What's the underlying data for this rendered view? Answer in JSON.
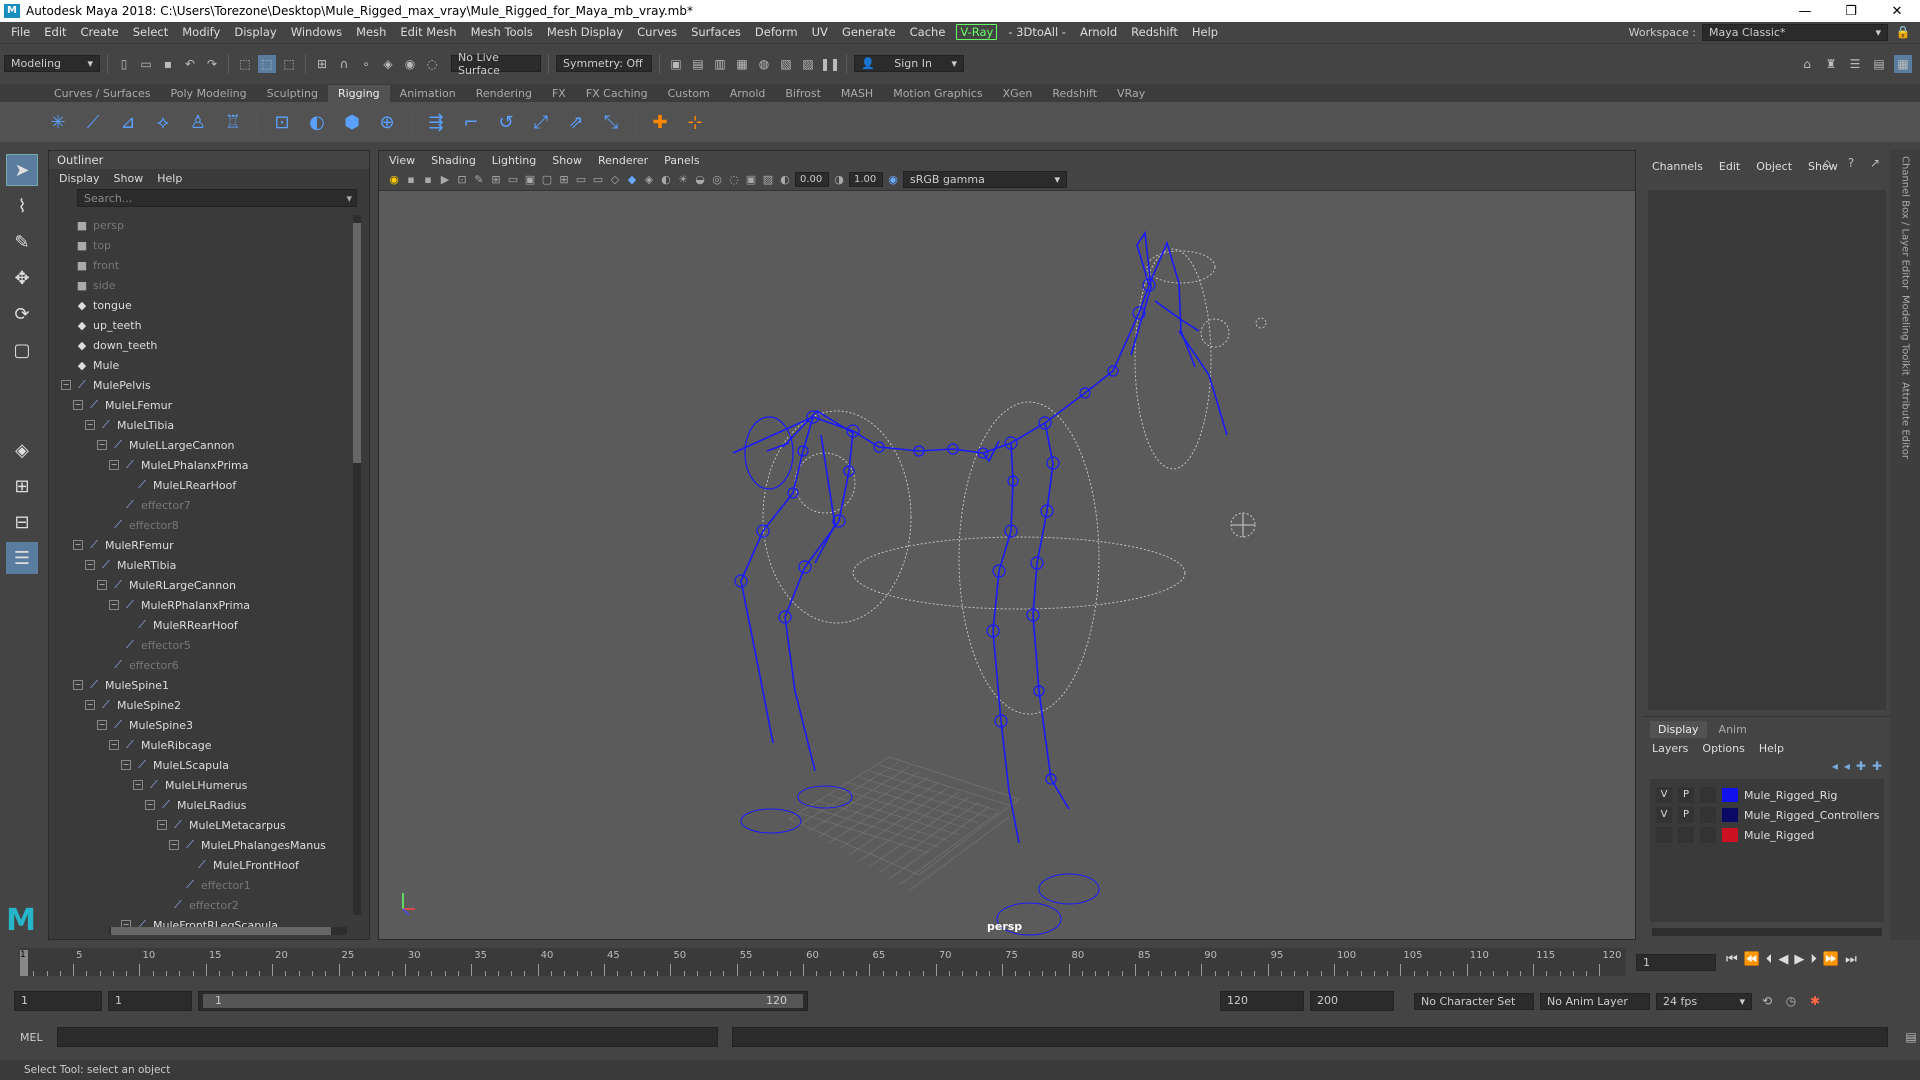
{
  "titlebar": {
    "logo": "M",
    "title": "Autodesk Maya 2018: C:\\Users\\Torezone\\Desktop\\Mule_Rigged_max_vray\\Mule_Rigged_for_Maya_mb_vray.mb*",
    "minimize": "—",
    "maximize": "❐",
    "close": "✕"
  },
  "menubar": {
    "items": [
      "File",
      "Edit",
      "Create",
      "Select",
      "Modify",
      "Display",
      "Windows",
      "Mesh",
      "Edit Mesh",
      "Mesh Tools",
      "Mesh Display",
      "Curves",
      "Surfaces",
      "Deform",
      "UV",
      "Generate",
      "Cache"
    ],
    "vray": "V-Ray",
    "items2": [
      "- 3DtoAll -",
      "Arnold",
      "Redshift",
      "Help"
    ],
    "workspace_label": "Workspace :",
    "workspace_value": "Maya Classic*"
  },
  "statusline": {
    "mode": "Modeling",
    "live_surface": "No Live Surface",
    "symmetry": "Symmetry: Off",
    "sign_in": "Sign In"
  },
  "shelf": {
    "tabs": [
      "Curves / Surfaces",
      "Poly Modeling",
      "Sculpting",
      "Rigging",
      "Animation",
      "Rendering",
      "FX",
      "FX Caching",
      "Custom",
      "Arnold",
      "Bifrost",
      "MASH",
      "Motion Graphics",
      "XGen",
      "Redshift",
      "VRay"
    ],
    "active": "Rigging"
  },
  "outliner": {
    "title": "Outliner",
    "menu": [
      "Display",
      "Show",
      "Help"
    ],
    "search_placeholder": "Search...",
    "items": [
      {
        "label": "persp",
        "depth": 0,
        "type": "cam",
        "dim": true,
        "exp": ""
      },
      {
        "label": "top",
        "depth": 0,
        "type": "cam",
        "dim": true,
        "exp": ""
      },
      {
        "label": "front",
        "depth": 0,
        "type": "cam",
        "dim": true,
        "exp": ""
      },
      {
        "label": "side",
        "depth": 0,
        "type": "cam",
        "dim": true,
        "exp": ""
      },
      {
        "label": "tongue",
        "depth": 0,
        "type": "mesh",
        "dim": false,
        "exp": ""
      },
      {
        "label": "up_teeth",
        "depth": 0,
        "type": "mesh",
        "dim": false,
        "exp": ""
      },
      {
        "label": "down_teeth",
        "depth": 0,
        "type": "mesh",
        "dim": false,
        "exp": ""
      },
      {
        "label": "Mule",
        "depth": 0,
        "type": "mesh",
        "dim": false,
        "exp": ""
      },
      {
        "label": "MulePelvis",
        "depth": 0,
        "type": "joint",
        "dim": false,
        "exp": "−"
      },
      {
        "label": "MuleLFemur",
        "depth": 1,
        "type": "joint",
        "dim": false,
        "exp": "−"
      },
      {
        "label": "MuleLTibia",
        "depth": 2,
        "type": "joint",
        "dim": false,
        "exp": "−"
      },
      {
        "label": "MuleLLargeCannon",
        "depth": 3,
        "type": "joint",
        "dim": false,
        "exp": "−"
      },
      {
        "label": "MuleLPhalanxPrima",
        "depth": 4,
        "type": "joint",
        "dim": false,
        "exp": "−"
      },
      {
        "label": "MuleLRearHoof",
        "depth": 5,
        "type": "joint",
        "dim": false,
        "exp": ""
      },
      {
        "label": "effector7",
        "depth": 4,
        "type": "joint",
        "dim": true,
        "exp": ""
      },
      {
        "label": "effector8",
        "depth": 3,
        "type": "joint",
        "dim": true,
        "exp": ""
      },
      {
        "label": "MuleRFemur",
        "depth": 1,
        "type": "joint",
        "dim": false,
        "exp": "−"
      },
      {
        "label": "MuleRTibia",
        "depth": 2,
        "type": "joint",
        "dim": false,
        "exp": "−"
      },
      {
        "label": "MuleRLargeCannon",
        "depth": 3,
        "type": "joint",
        "dim": false,
        "exp": "−"
      },
      {
        "label": "MuleRPhalanxPrima",
        "depth": 4,
        "type": "joint",
        "dim": false,
        "exp": "−"
      },
      {
        "label": "MuleRRearHoof",
        "depth": 5,
        "type": "joint",
        "dim": false,
        "exp": ""
      },
      {
        "label": "effector5",
        "depth": 4,
        "type": "joint",
        "dim": true,
        "exp": ""
      },
      {
        "label": "effector6",
        "depth": 3,
        "type": "joint",
        "dim": true,
        "exp": ""
      },
      {
        "label": "MuleSpine1",
        "depth": 1,
        "type": "joint",
        "dim": false,
        "exp": "−"
      },
      {
        "label": "MuleSpine2",
        "depth": 2,
        "type": "joint",
        "dim": false,
        "exp": "−"
      },
      {
        "label": "MuleSpine3",
        "depth": 3,
        "type": "joint",
        "dim": false,
        "exp": "−"
      },
      {
        "label": "MuleRibcage",
        "depth": 4,
        "type": "joint",
        "dim": false,
        "exp": "−"
      },
      {
        "label": "MuleLScapula",
        "depth": 5,
        "type": "joint",
        "dim": false,
        "exp": "−"
      },
      {
        "label": "MuleLHumerus",
        "depth": 6,
        "type": "joint",
        "dim": false,
        "exp": "−"
      },
      {
        "label": "MuleLRadius",
        "depth": 7,
        "type": "joint",
        "dim": false,
        "exp": "−"
      },
      {
        "label": "MuleLMetacarpus",
        "depth": 8,
        "type": "joint",
        "dim": false,
        "exp": "−"
      },
      {
        "label": "MuleLPhalangesManus",
        "depth": 9,
        "type": "joint",
        "dim": false,
        "exp": "−"
      },
      {
        "label": "MuleLFrontHoof",
        "depth": 10,
        "type": "joint",
        "dim": false,
        "exp": ""
      },
      {
        "label": "effector1",
        "depth": 9,
        "type": "joint",
        "dim": true,
        "exp": ""
      },
      {
        "label": "effector2",
        "depth": 8,
        "type": "joint",
        "dim": true,
        "exp": ""
      },
      {
        "label": "MuleFrontRLegScapula",
        "depth": 5,
        "type": "joint",
        "dim": false,
        "exp": "−"
      }
    ]
  },
  "viewport": {
    "menu": [
      "View",
      "Shading",
      "Lighting",
      "Show",
      "Renderer",
      "Panels"
    ],
    "exposure": "0.00",
    "gamma": "1.00",
    "colorspace": "sRGB gamma",
    "camera": "persp"
  },
  "channelbox": {
    "menu": [
      "Channels",
      "Edit",
      "Object",
      "Show"
    ]
  },
  "layers": {
    "tabs": [
      "Display",
      "Anim"
    ],
    "active": "Display",
    "menu": [
      "Layers",
      "Options",
      "Help"
    ],
    "rows": [
      {
        "v": "V",
        "p": "P",
        "name": "Mule_Rigged_Rig",
        "color": "#1111ee"
      },
      {
        "v": "V",
        "p": "P",
        "name": "Mule_Rigged_Controllers",
        "color": "#0a0a66"
      },
      {
        "v": "",
        "p": "",
        "name": "Mule_Rigged",
        "color": "#cc1122"
      }
    ]
  },
  "rightstrip": {
    "labels": [
      "Channel Box / Layer Editor",
      "Modeling Toolkit",
      "Attribute Editor"
    ]
  },
  "timeslider": {
    "ticks": [
      "5",
      "10",
      "15",
      "20",
      "25",
      "30",
      "35",
      "40",
      "45",
      "50",
      "55",
      "60",
      "65",
      "70",
      "75",
      "80",
      "85",
      "90",
      "95",
      "100",
      "105",
      "110",
      "115",
      "120"
    ],
    "current_frame": "1",
    "current_frame_field": "1"
  },
  "range": {
    "start": "1",
    "start2": "1",
    "range_start": "1",
    "range_end": "120",
    "end": "120",
    "end2": "200",
    "character_set": "No Character Set",
    "anim_layer": "No Anim Layer",
    "fps": "24 fps"
  },
  "cmdline": {
    "label": "MEL"
  },
  "helpline": {
    "text": "Select Tool: select an object"
  },
  "colors": {
    "rig_blue": "#1a1aff",
    "accent": "#5a7c9e"
  }
}
